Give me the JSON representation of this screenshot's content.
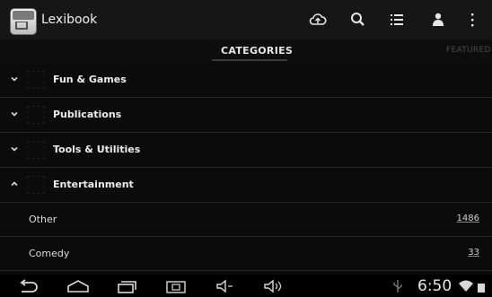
{
  "action_bar": {
    "app_name": "Lexibook",
    "icons": [
      "cloud-upload-icon",
      "search-icon",
      "list-icon",
      "account-icon",
      "overflow-menu-icon"
    ]
  },
  "tabs": [
    {
      "label": "CATEGORIES",
      "active": true
    },
    {
      "label": "FEATURED",
      "active": false
    }
  ],
  "categories": [
    {
      "label": "Fun & Games",
      "expanded": false
    },
    {
      "label": "Publications",
      "expanded": false
    },
    {
      "label": "Tools & Utilities",
      "expanded": false
    },
    {
      "label": "Entertainment",
      "expanded": true
    }
  ],
  "subcategories": [
    {
      "label": "Other",
      "count": "1486"
    },
    {
      "label": "Comedy",
      "count": "33"
    }
  ],
  "system_bar": {
    "time": "6:50",
    "icons": [
      "back-icon",
      "home-icon",
      "recent-apps-icon",
      "screenshot-icon",
      "volume-down-icon",
      "volume-up-icon",
      "usb-icon",
      "wifi-icon",
      "battery-icon"
    ]
  },
  "colors": {
    "background": "#0b0b0b",
    "action_bar": "#161616",
    "divider": "#262626",
    "text": "#e8e8e8"
  }
}
